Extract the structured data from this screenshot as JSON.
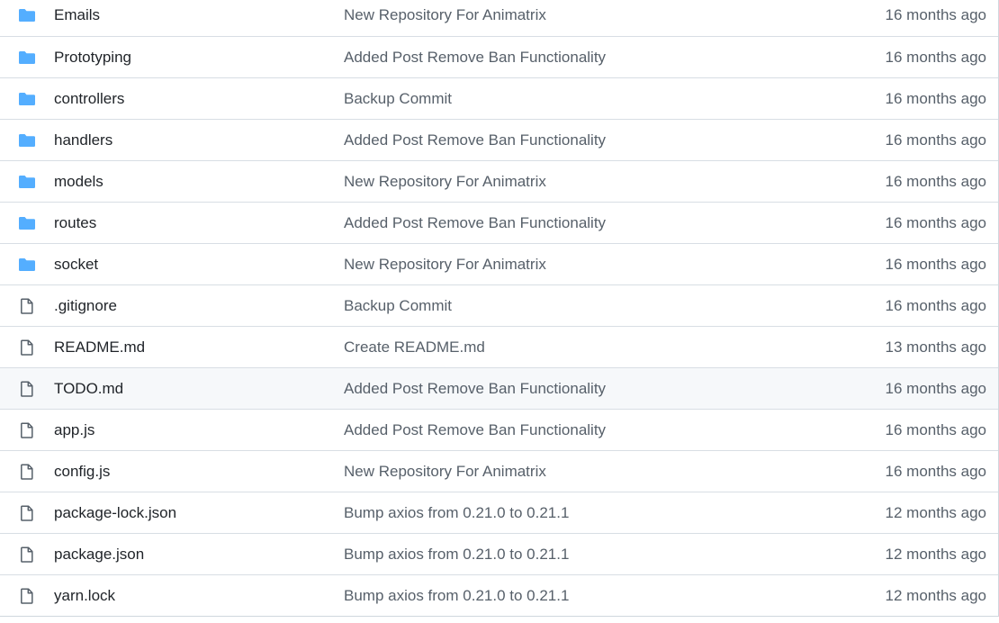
{
  "colors": {
    "folder_icon": "#54aeff",
    "file_icon": "#57606a",
    "name_text": "#1f2328",
    "muted_text": "#57606a",
    "row_hover": "#f6f8fa",
    "border": "#d8dee4"
  },
  "files": [
    {
      "type": "folder",
      "icon": "folder-icon",
      "name": "Emails",
      "message": "New Repository For Animatrix",
      "age": "16 months ago"
    },
    {
      "type": "folder",
      "icon": "folder-icon",
      "name": "Prototyping",
      "message": "Added Post Remove Ban Functionality",
      "age": "16 months ago"
    },
    {
      "type": "folder",
      "icon": "folder-icon",
      "name": "controllers",
      "message": "Backup Commit",
      "age": "16 months ago"
    },
    {
      "type": "folder",
      "icon": "folder-icon",
      "name": "handlers",
      "message": "Added Post Remove Ban Functionality",
      "age": "16 months ago"
    },
    {
      "type": "folder",
      "icon": "folder-icon",
      "name": "models",
      "message": "New Repository For Animatrix",
      "age": "16 months ago"
    },
    {
      "type": "folder",
      "icon": "folder-icon",
      "name": "routes",
      "message": "Added Post Remove Ban Functionality",
      "age": "16 months ago"
    },
    {
      "type": "folder",
      "icon": "folder-icon",
      "name": "socket",
      "message": "New Repository For Animatrix",
      "age": "16 months ago"
    },
    {
      "type": "file",
      "icon": "file-icon",
      "name": ".gitignore",
      "message": "Backup Commit",
      "age": "16 months ago"
    },
    {
      "type": "file",
      "icon": "file-icon",
      "name": "README.md",
      "message": "Create README.md",
      "age": "13 months ago"
    },
    {
      "type": "file",
      "icon": "file-icon",
      "name": "TODO.md",
      "message": "Added Post Remove Ban Functionality",
      "age": "16 months ago",
      "hovered": true
    },
    {
      "type": "file",
      "icon": "file-icon",
      "name": "app.js",
      "message": "Added Post Remove Ban Functionality",
      "age": "16 months ago"
    },
    {
      "type": "file",
      "icon": "file-icon",
      "name": "config.js",
      "message": "New Repository For Animatrix",
      "age": "16 months ago"
    },
    {
      "type": "file",
      "icon": "file-icon",
      "name": "package-lock.json",
      "message": "Bump axios from 0.21.0 to 0.21.1",
      "age": "12 months ago"
    },
    {
      "type": "file",
      "icon": "file-icon",
      "name": "package.json",
      "message": "Bump axios from 0.21.0 to 0.21.1",
      "age": "12 months ago"
    },
    {
      "type": "file",
      "icon": "file-icon",
      "name": "yarn.lock",
      "message": "Bump axios from 0.21.0 to 0.21.1",
      "age": "12 months ago"
    }
  ]
}
